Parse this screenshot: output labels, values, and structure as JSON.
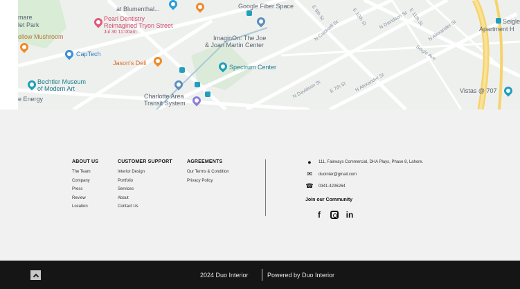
{
  "map": {
    "labels": {
      "blumenthal": "at Blumenthal...",
      "pearl_dentistry": "Pearl Dentistry",
      "reimagined_tryon": "Reimagined Tryon Street",
      "event_time": "Jul 30 11:00am",
      "mare": "mare",
      "let_park": "let Park",
      "yellow_mushroom": "ellow Mushroom",
      "google_fiber": "Google Fiber Space",
      "imaginon_1": "ImaginOn: The Joe",
      "imaginon_2": "& Joan Martin Center",
      "captech": "CapTech",
      "jasons_deli": "Jason's Deli",
      "spectrum": "Spectrum Center",
      "bechtler_1": "Bechtler Museum",
      "bechtler_2": "of Modern Art",
      "energy": "e Energy",
      "charlotte_1": "Charlotte Area",
      "charlotte_2": "Transit System",
      "seigle_1": "Seigle",
      "seigle_2": "Apartment H",
      "vistas": "Vistas @ 707",
      "st_caldwell": "N Caldwell St",
      "st_davidson": "N Davidson St",
      "st_davidson_2": "N Davidson St",
      "st_7th": "E 7th St",
      "st_alexander": "N Alexander St",
      "st_8th": "E 8th St",
      "st_9th": "E 9th St",
      "st_10th": "E 10th St",
      "st_11th": "E 11th St",
      "st_brevard": "N Brevard St",
      "st_myers": "N Myers St",
      "st_alexander_2": "N Alexander St",
      "st_seigle": "Seigle Ave"
    }
  },
  "footer": {
    "about": {
      "title": "ABOUT US",
      "links": [
        "The Team",
        "Company",
        "Press",
        "Review",
        "Location"
      ]
    },
    "support": {
      "title": "CUSTOMER SUPPORT",
      "links": [
        "Interior Design",
        "Portfolio",
        "Services",
        "About",
        "Contact Us"
      ]
    },
    "agreements": {
      "title": "AGREEMENTS",
      "links": [
        "Our Terms & Condition",
        "Privacy Policy"
      ]
    },
    "contact": {
      "address": "111, Fairways Commercial, DHA Plays, Phase 8, Lahore.",
      "email": "duointer@gmail.com",
      "phone": "0341-4206264"
    },
    "community_title": "Join our Community",
    "socials": [
      "facebook-icon",
      "instagram-icon",
      "linkedin-icon"
    ]
  },
  "bottom_bar": {
    "copyright": "2024 Duo Interior",
    "powered": "Powered by Duo Interior"
  },
  "colors": {
    "map_bg": "#eef0ee",
    "footer_bg": "#f1f1f1",
    "bar_bg": "#151515",
    "highway_yellow": "#f6d36b"
  }
}
